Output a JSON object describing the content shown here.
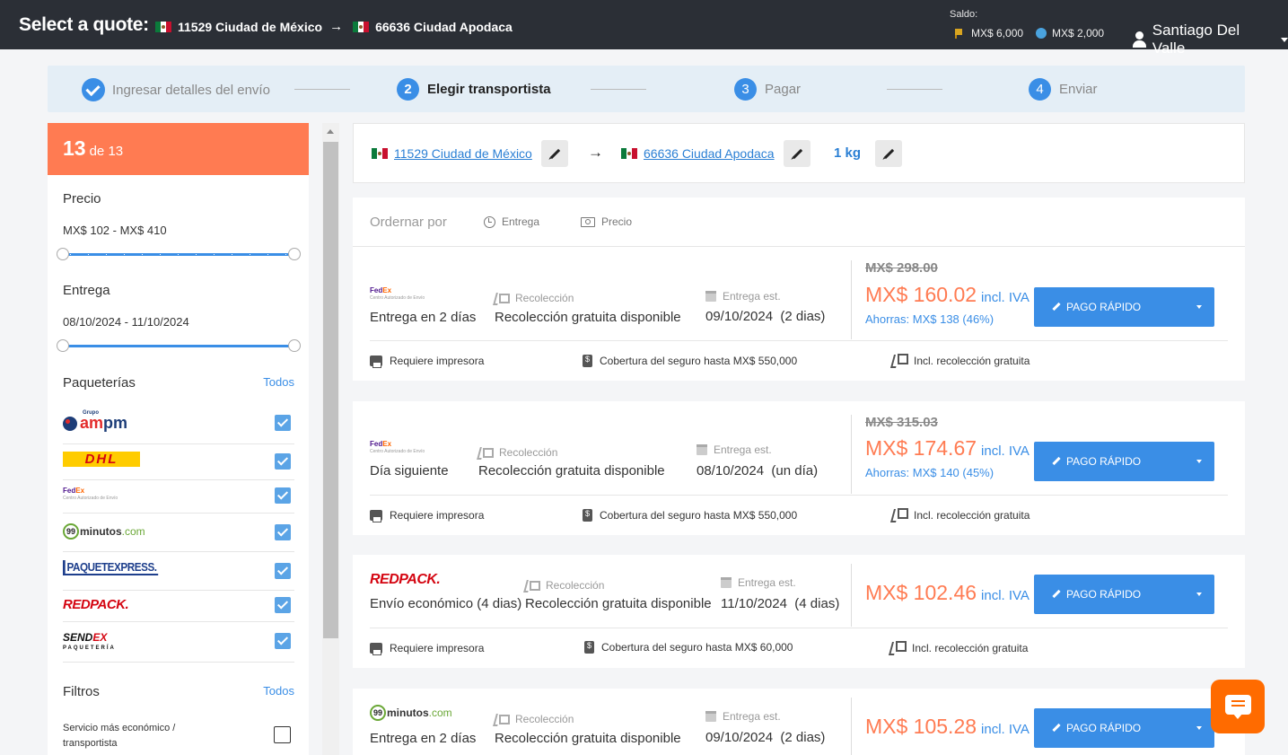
{
  "header": {
    "title": "Select a quote:",
    "origin": "11529 Ciudad de México",
    "destination": "66636 Ciudad Apodaca",
    "saldo_label": "Saldo:",
    "saldo_flag": "MX$ 6,000",
    "saldo_globe": "MX$ 2,000",
    "user_name": "Santiago Del Valle"
  },
  "stepper": {
    "steps": [
      {
        "num": "",
        "label": "Ingresar detalles del envío",
        "state": "done"
      },
      {
        "num": "2",
        "label": "Elegir transportista",
        "state": "active"
      },
      {
        "num": "3",
        "label": "Pagar",
        "state": "pending"
      },
      {
        "num": "4",
        "label": "Enviar",
        "state": "pending"
      }
    ]
  },
  "sidebar": {
    "count": "13",
    "count_of": "de 13",
    "price": {
      "title": "Precio",
      "range": "MX$ 102 - MX$ 410",
      "min": 0,
      "max": 1
    },
    "delivery": {
      "title": "Entrega",
      "range": "08/10/2024 - 11/10/2024",
      "min": 0,
      "max": 1
    },
    "carriers": {
      "title": "Paqueterías",
      "all_link": "Todos",
      "items": [
        {
          "name": "ampm",
          "checked": true
        },
        {
          "name": "DHL",
          "checked": true
        },
        {
          "name": "FedEx",
          "checked": true
        },
        {
          "name": "99minutos",
          "checked": true
        },
        {
          "name": "Paquetexpress",
          "checked": true
        },
        {
          "name": "Redpack",
          "checked": true
        },
        {
          "name": "Sendex",
          "checked": true
        }
      ],
      "logo_text": {
        "ampm_grupo": "Grupo",
        "ampm_am": "am",
        "ampm_pm": "pm",
        "dhl": "DHL",
        "fedex_fed": "Fed",
        "fedex_ex": "Ex",
        "fedex_sub": "Centro Autorizado de Envío",
        "nn_circle": "99",
        "nn_text": "minutos",
        "nn_com": ".com",
        "paq": "PAQUETEXPRESS.",
        "redpack": "REDPACK.",
        "sendex_a": "SEND",
        "sendex_x": "EX",
        "sendex_sub": "PAQUETERÍA"
      }
    },
    "filters": {
      "title": "Filtros",
      "all_link": "Todos",
      "items": [
        {
          "label": "Servicio más económico / transportista",
          "checked": false
        }
      ]
    }
  },
  "routebar": {
    "origin": "11529 Ciudad de México",
    "destination": "66636 Ciudad Apodaca",
    "weight": "1 kg",
    "arrow": "→"
  },
  "sort": {
    "label": "Ordernar por",
    "options": [
      "Entrega",
      "Precio"
    ]
  },
  "quotes": [
    {
      "carrier": "FedEx",
      "service": "Entrega en 2 días",
      "pickup_label": "Recolección",
      "pickup": "Recolección gratuita disponible",
      "eta_label": "Entrega est.",
      "eta": "09/10/2024  (2 dias)",
      "old_price": "MX$ 298.00",
      "price": "MX$ 160.02",
      "iva": "incl. IVA",
      "savings": "Ahorras: MX$ 138 (46%)",
      "button": "PAGO RÁPIDO",
      "features": [
        "Requiere impresora",
        "Cobertura del seguro hasta MX$ 550,000",
        "Incl. recolección gratuita"
      ]
    },
    {
      "carrier": "FedEx",
      "service": "Día siguiente",
      "pickup_label": "Recolección",
      "pickup": "Recolección gratuita disponible",
      "eta_label": "Entrega est.",
      "eta": "08/10/2024  (un día)",
      "old_price": "MX$ 315.03",
      "price": "MX$ 174.67",
      "iva": "incl. IVA",
      "savings": "Ahorras: MX$ 140 (45%)",
      "button": "PAGO RÁPIDO",
      "features": [
        "Requiere impresora",
        "Cobertura del seguro hasta MX$ 550,000",
        "Incl. recolección gratuita"
      ]
    },
    {
      "carrier": "Redpack",
      "service": "Envío económico (4 dias)",
      "pickup_label": "Recolección",
      "pickup": "Recolección gratuita disponible",
      "eta_label": "Entrega est.",
      "eta": "11/10/2024  (4 dias)",
      "old_price": "",
      "price": "MX$ 102.46",
      "iva": "incl. IVA",
      "savings": "",
      "button": "PAGO RÁPIDO",
      "features": [
        "Requiere impresora",
        "Cobertura del seguro hasta MX$ 60,000",
        "Incl. recolección gratuita"
      ]
    },
    {
      "carrier": "99minutos",
      "service": "Entrega en 2 días",
      "pickup_label": "Recolección",
      "pickup": "Recolección gratuita disponible",
      "eta_label": "Entrega est.",
      "eta": "09/10/2024  (2 dias)",
      "old_price": "",
      "price": "MX$ 105.28",
      "iva": "incl. IVA",
      "savings": "",
      "button": "PAGO RÁPIDO",
      "features": []
    }
  ],
  "colors": {
    "accent": "#3a8ee6",
    "orange": "#ff7b52",
    "topbar": "#2b2f36",
    "chat": "#ff6b00"
  }
}
